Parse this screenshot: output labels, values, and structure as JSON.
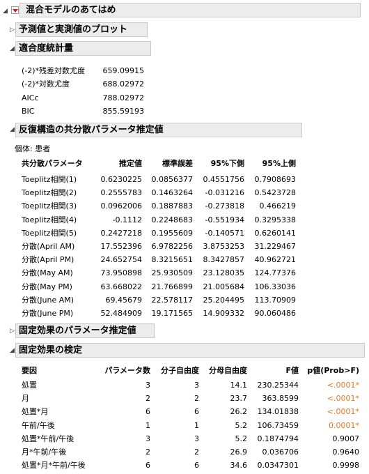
{
  "main_header": "混合モデルのあてはめ",
  "sections": {
    "plot": "予測値と実測値のプロット",
    "fit": "適合度統計量",
    "cov": "反復構造の共分散パラメータ推定値",
    "fixed_est": "固定効果のパラメータ推定値",
    "fixed_test": "固定効果の検定"
  },
  "fit_stats": [
    {
      "label": "(-2)*残差対数尤度",
      "value": "659.09915"
    },
    {
      "label": "(-2)*対数尤度",
      "value": "688.02972"
    },
    {
      "label": "AICc",
      "value": "788.02972"
    },
    {
      "label": "BIC",
      "value": "855.59193"
    }
  ],
  "cov_subject": "個体: 患者",
  "cov_headers": [
    "共分散パラメータ",
    "推定値",
    "標準誤差",
    "95%下側",
    "95%上側"
  ],
  "cov_rows": [
    [
      "Toeplitz相関(1)",
      "0.6230225",
      "0.0856377",
      "0.4551756",
      "0.7908693"
    ],
    [
      "Toeplitz相関(2)",
      "0.2555783",
      "0.1463264",
      "-0.031216",
      "0.5423728"
    ],
    [
      "Toeplitz相関(3)",
      "0.0962006",
      "0.1887883",
      "-0.273818",
      "0.466219"
    ],
    [
      "Toeplitz相関(4)",
      "-0.1112",
      "0.2248683",
      "-0.551934",
      "0.3295338"
    ],
    [
      "Toeplitz相関(5)",
      "0.2427218",
      "0.1955609",
      "-0.140571",
      "0.6260141"
    ],
    [
      "分散(April AM)",
      "17.552396",
      "6.9782256",
      "3.8753253",
      "31.229467"
    ],
    [
      "分散(April PM)",
      "24.652754",
      "8.3215651",
      "8.3427857",
      "40.962721"
    ],
    [
      "分散(May AM)",
      "73.950898",
      "25.930509",
      "23.128035",
      "124.77376"
    ],
    [
      "分散(May PM)",
      "63.668022",
      "21.766899",
      "21.005684",
      "106.33036"
    ],
    [
      "分散(June AM)",
      "69.45679",
      "22.578117",
      "25.204495",
      "113.70909"
    ],
    [
      "分散(June PM)",
      "52.484909",
      "19.171565",
      "14.909332",
      "90.060486"
    ]
  ],
  "test_headers": [
    "要因",
    "パラメータ数",
    "分子自由度",
    "分母自由度",
    "F値",
    "p値(Prob>F)"
  ],
  "test_rows": [
    [
      "処置",
      "3",
      "3",
      "14.1",
      "230.25344",
      "<.0001*"
    ],
    [
      "月",
      "2",
      "2",
      "23.7",
      "363.8599",
      "<.0001*"
    ],
    [
      "処置*月",
      "6",
      "6",
      "26.2",
      "134.01838",
      "<.0001*"
    ],
    [
      "午前/午後",
      "1",
      "1",
      "5.2",
      "106.73459",
      "0.0001*"
    ],
    [
      "処置*午前/午後",
      "3",
      "3",
      "5.2",
      "0.1874794",
      "0.9007"
    ],
    [
      "月*午前/午後",
      "2",
      "2",
      "26.9",
      "0.036706",
      "0.9640"
    ],
    [
      "処置*月*午前/午後",
      "6",
      "6",
      "34.6",
      "0.0347301",
      "0.9998"
    ]
  ],
  "colors": {
    "significant": "#e07820",
    "header_bg": "#ececec"
  }
}
